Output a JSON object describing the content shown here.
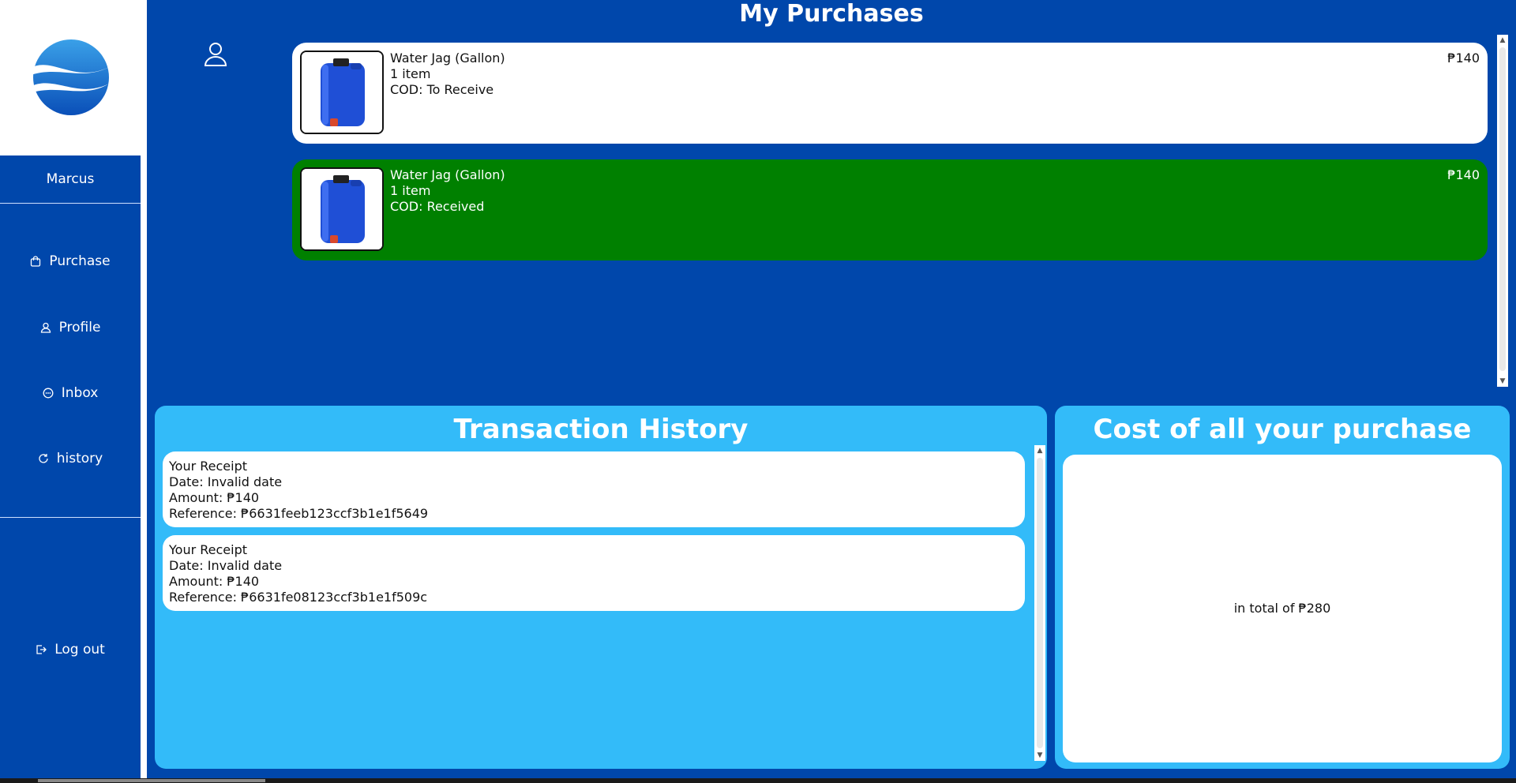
{
  "sidebar": {
    "user_name": "Marcus",
    "items": [
      {
        "label": "Purchase",
        "icon": "shopping-bag-icon"
      },
      {
        "label": "Profile",
        "icon": "user-icon"
      },
      {
        "label": "Inbox",
        "icon": "chat-icon"
      },
      {
        "label": "history",
        "icon": "refresh-icon"
      }
    ],
    "logout_label": "Log out"
  },
  "header": {
    "title": "My Purchases"
  },
  "purchases": [
    {
      "name": "Water Jag (Gallon)",
      "qty": "1 item",
      "status": "COD: To Receive",
      "price": "₱140",
      "state": "pending"
    },
    {
      "name": "Water Jag (Gallon)",
      "qty": "1 item",
      "status": "COD: Received",
      "price": "₱140",
      "state": "received"
    }
  ],
  "transactions": {
    "title": "Transaction History",
    "receipts": [
      {
        "heading": "Your Receipt",
        "date": "Date: Invalid date",
        "amount": "Amount: ₱140",
        "reference": "Reference: ₱6631feeb123ccf3b1e1f5649"
      },
      {
        "heading": "Your Receipt",
        "date": "Date: Invalid date",
        "amount": "Amount: ₱140",
        "reference": "Reference: ₱6631fe08123ccf3b1e1f509c"
      }
    ]
  },
  "cost": {
    "title": "Cost of all your purchase",
    "total_text": "in total of ₱280"
  },
  "colors": {
    "primary_blue": "#0047AB",
    "panel_blue": "#33BBF9",
    "received_green": "#008000"
  }
}
